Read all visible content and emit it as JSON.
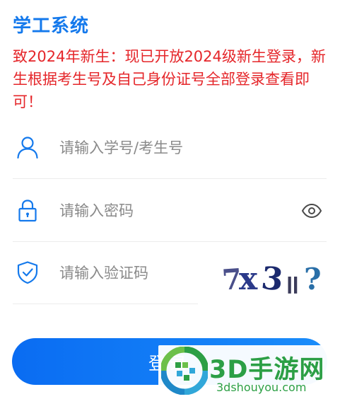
{
  "header": {
    "title": "学工系统"
  },
  "notice": {
    "text": "致2024年新生：现已开放2024级新生登录，新生根据考生号及自己身份证号全部登录查看即可！"
  },
  "form": {
    "username": {
      "placeholder": "请输入学号/考生号",
      "icon": "user-icon"
    },
    "password": {
      "placeholder": "请输入密码",
      "icon": "lock-icon",
      "toggle_icon": "eye-icon"
    },
    "captcha": {
      "placeholder": "请输入验证码",
      "icon": "shield-check-icon",
      "image_text": "7x3=?"
    },
    "login_label": "登录"
  },
  "watermark": {
    "name": "3D手游网",
    "url": "3dshouyou.com"
  },
  "colors": {
    "accent": "#1479ec",
    "notice": "#e5262a",
    "button": "#0a6cf2",
    "watermark": "#2c9f45"
  }
}
